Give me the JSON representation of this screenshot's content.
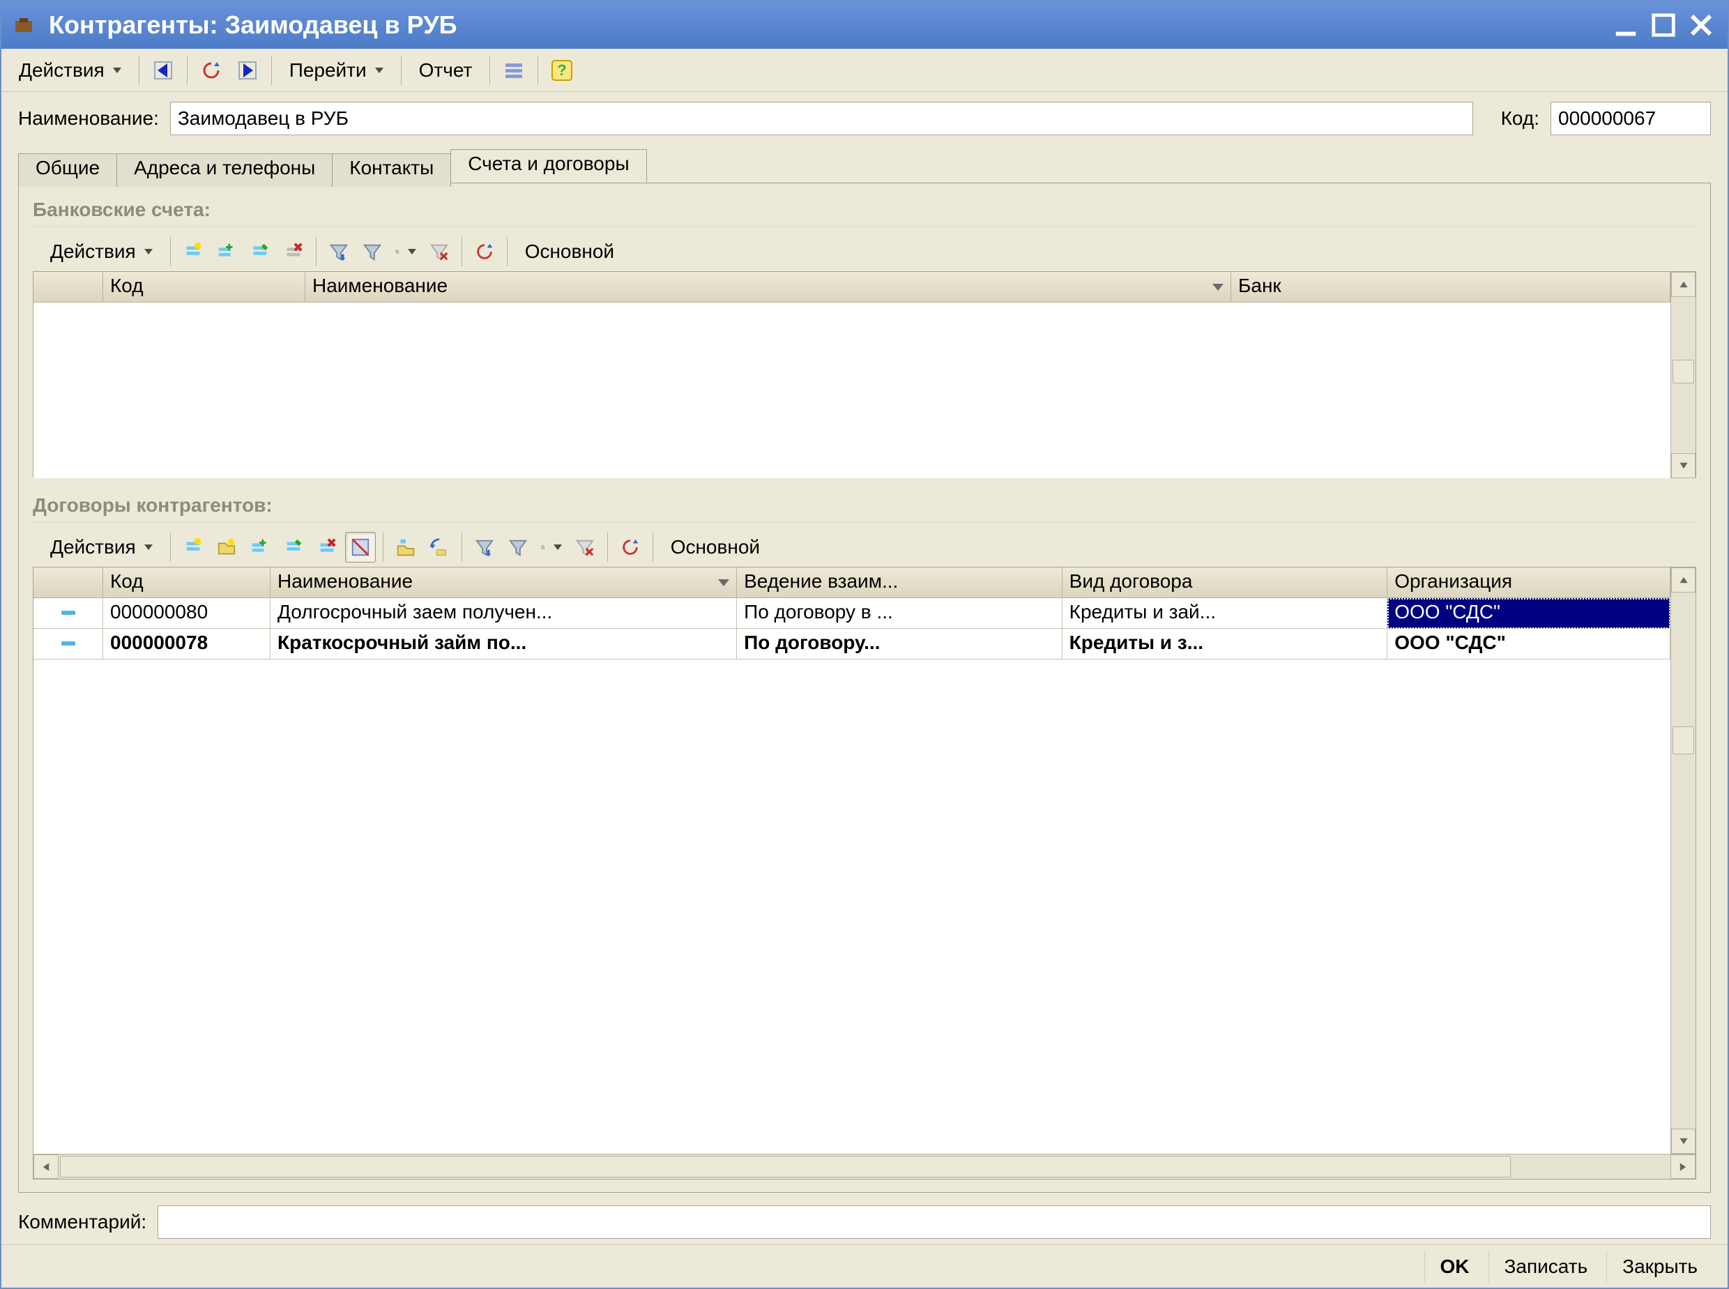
{
  "window": {
    "title": "Контрагенты: Заимодавец в РУБ"
  },
  "main_toolbar": {
    "actions": "Действия",
    "goto": "Перейти",
    "report": "Отчет"
  },
  "fields": {
    "name_label": "Наименование:",
    "name_value": "Заимодавец в РУБ",
    "code_label": "Код:",
    "code_value": "000000067",
    "comment_label": "Комментарий:",
    "comment_value": ""
  },
  "tabs": {
    "general": "Общие",
    "addresses": "Адреса и телефоны",
    "contacts": "Контакты",
    "accounts": "Счета и договоры"
  },
  "bank_section": {
    "title": "Банковские счета:",
    "actions": "Действия",
    "main": "Основной",
    "columns": {
      "code": "Код",
      "name": "Наименование",
      "bank": "Банк"
    }
  },
  "contracts_section": {
    "title": "Договоры контрагентов:",
    "actions": "Действия",
    "main": "Основной",
    "columns": {
      "code": "Код",
      "name": "Наименование",
      "settlement": "Ведение взаим...",
      "type": "Вид договора",
      "org": "Организация"
    },
    "rows": [
      {
        "code": "000000080",
        "name": "Долгосрочный заем получен...",
        "settlement": "По договору в ...",
        "type": "Кредиты и зай...",
        "org": "ООО \"СДС\"",
        "bold": false,
        "selected_col": "org"
      },
      {
        "code": "000000078",
        "name": "Краткосрочный займ по...",
        "settlement": "По договору...",
        "type": "Кредиты и з...",
        "org": "ООО \"СДС\"",
        "bold": true,
        "selected_col": null
      }
    ]
  },
  "footer": {
    "ok": "OK",
    "save": "Записать",
    "close": "Закрыть"
  }
}
